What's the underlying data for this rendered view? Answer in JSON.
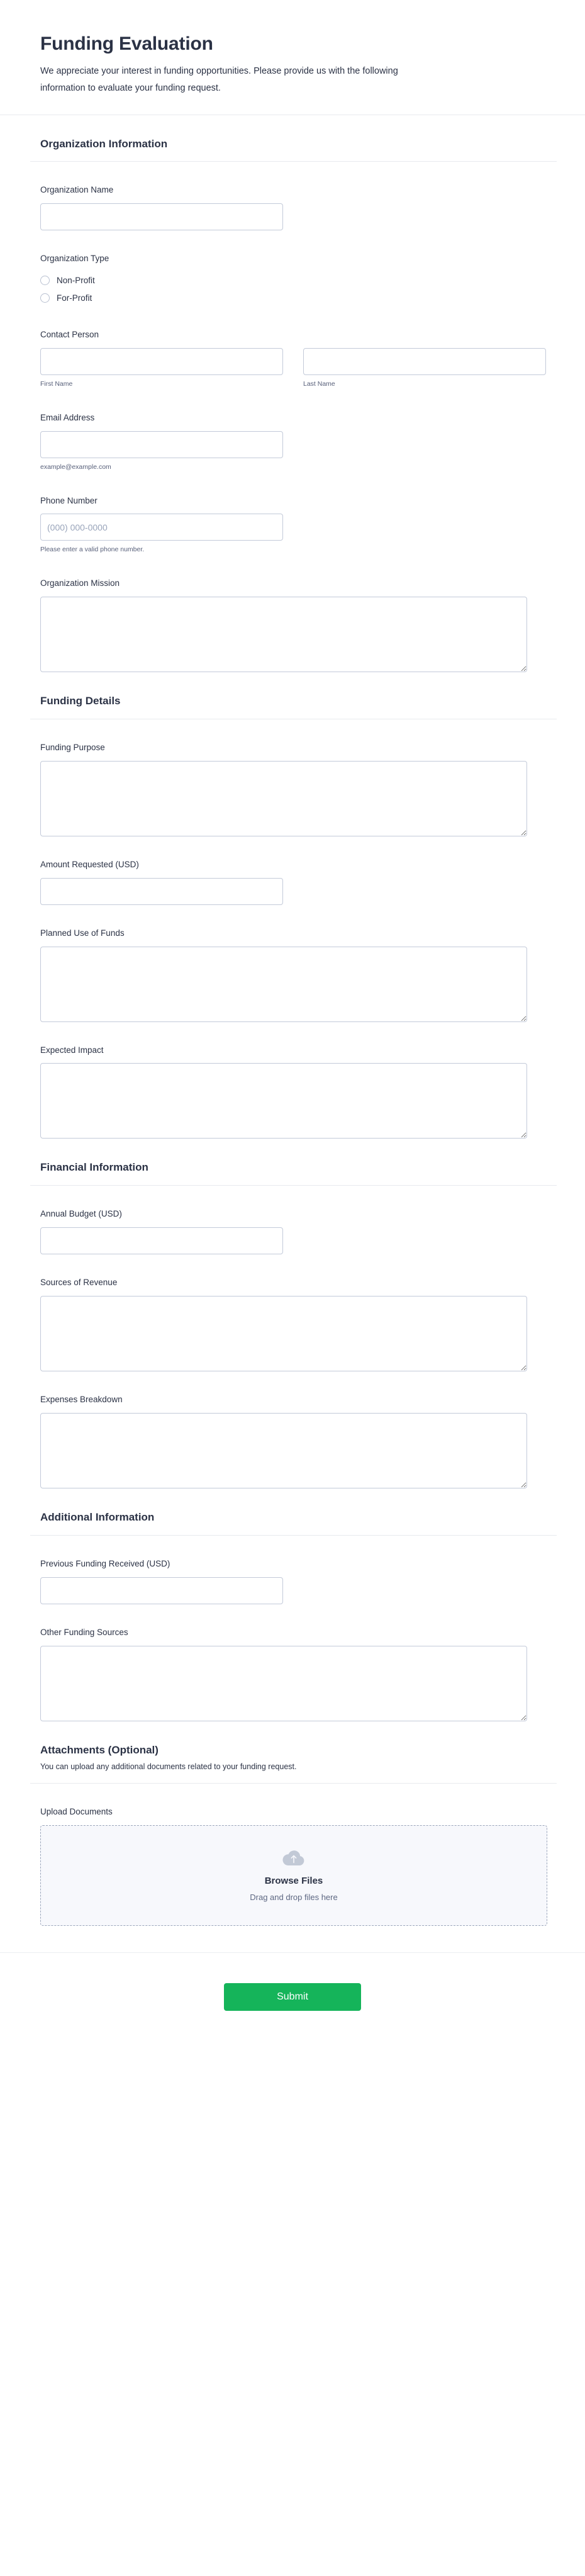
{
  "header": {
    "title": "Funding Evaluation",
    "subtitle": "We appreciate your interest in funding opportunities. Please provide us with the following information to evaluate your funding request."
  },
  "sections": [
    {
      "title": "Organization Information",
      "description": "",
      "fields": {
        "organization_name": {
          "label": "Organization Name",
          "value": "",
          "placeholder": ""
        },
        "organization_type": {
          "label": "Organization Type",
          "options": [
            {
              "label": "Non-Profit",
              "selected": false
            },
            {
              "label": "For-Profit",
              "selected": false
            }
          ]
        },
        "contact_person": {
          "label": "Contact Person",
          "first": {
            "value": "",
            "placeholder": "",
            "hint": "First Name"
          },
          "last": {
            "value": "",
            "placeholder": "",
            "hint": "Last Name"
          }
        },
        "email_address": {
          "label": "Email Address",
          "value": "",
          "placeholder": "",
          "hint": "example@example.com"
        },
        "phone_number": {
          "label": "Phone Number",
          "value": "",
          "placeholder": "(000) 000-0000",
          "hint": "Please enter a valid phone number."
        },
        "organization_mission": {
          "label": "Organization Mission",
          "value": "",
          "placeholder": ""
        }
      }
    },
    {
      "title": "Funding Details",
      "description": "",
      "fields": {
        "funding_purpose": {
          "label": "Funding Purpose",
          "value": "",
          "placeholder": ""
        },
        "amount_requested": {
          "label": "Amount Requested (USD)",
          "value": "",
          "placeholder": ""
        },
        "planned_use_of_funds": {
          "label": "Planned Use of Funds",
          "value": "",
          "placeholder": ""
        },
        "expected_impact": {
          "label": "Expected Impact",
          "value": "",
          "placeholder": ""
        }
      }
    },
    {
      "title": "Financial Information",
      "description": "",
      "fields": {
        "annual_budget": {
          "label": "Annual Budget (USD)",
          "value": "",
          "placeholder": ""
        },
        "sources_of_revenue": {
          "label": "Sources of Revenue",
          "value": "",
          "placeholder": ""
        },
        "expenses_breakdown": {
          "label": "Expenses Breakdown",
          "value": "",
          "placeholder": ""
        }
      }
    },
    {
      "title": "Additional Information",
      "description": "",
      "fields": {
        "previous_funding_received": {
          "label": "Previous Funding Received (USD)",
          "value": "",
          "placeholder": ""
        },
        "other_funding_sources": {
          "label": "Other Funding Sources",
          "value": "",
          "placeholder": ""
        }
      }
    },
    {
      "title": "Attachments (Optional)",
      "description": "You can upload any additional documents related to your funding request.",
      "fields": {
        "upload_documents": {
          "label": "Upload Documents",
          "browse_label": "Browse Files",
          "drop_label": "Drag and drop files here",
          "icon": "cloud-upload-icon"
        }
      }
    }
  ],
  "footer": {
    "submit_label": "Submit"
  },
  "colors": {
    "text": "#2b3245",
    "muted": "#58607a",
    "border": "#c3cad9",
    "rule": "#e8eaee",
    "submit": "#15b45a",
    "dropzone_bg": "#f7f8fc"
  }
}
